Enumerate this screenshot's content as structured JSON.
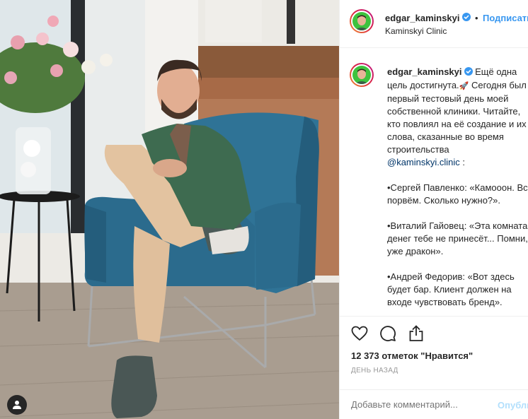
{
  "header": {
    "username": "edgar_kaminskyi",
    "separator": "•",
    "follow_label": "Подписаться",
    "location": "Kaminskyi Clinic"
  },
  "caption": {
    "username": "edgar_kaminskyi",
    "text_1": "Ещё одна цель достигнута.",
    "rocket": "🚀",
    "text_2": " Сегодня был первый тестовый день моей собственной клиники. Читайте, кто повлиял на её создание и их слова, сказанные во время строительства",
    "mention": "@kaminskyi.clinic",
    "text_3": " :\n\n•Сергей Павленко: «Камооон. Все порвём. Сколько нужно?».\n\n•Виталий Гайовец: «Эта комната денег тебе не принесёт... Помни, уже дракон».\n\n•Андрей Федорив: «Вот здесь будет бар. Клиент должен на входе чувствовать бренд».\n\n•Влад Ноздрачёв: «Андрологи"
  },
  "actions": {
    "like_icon": "heart-icon",
    "comment_icon": "comment-icon",
    "share_icon": "share-icon",
    "likes": "12 373 отметок \"Нравится\"",
    "time": "ДЕНЬ НАЗАД"
  },
  "comment": {
    "placeholder": "Добавьте комментарий...",
    "publish_label": "Опубликовать"
  },
  "colors": {
    "link": "#3897f0",
    "publish_disabled": "#b2dffc",
    "text": "#262626",
    "muted": "#999999"
  }
}
